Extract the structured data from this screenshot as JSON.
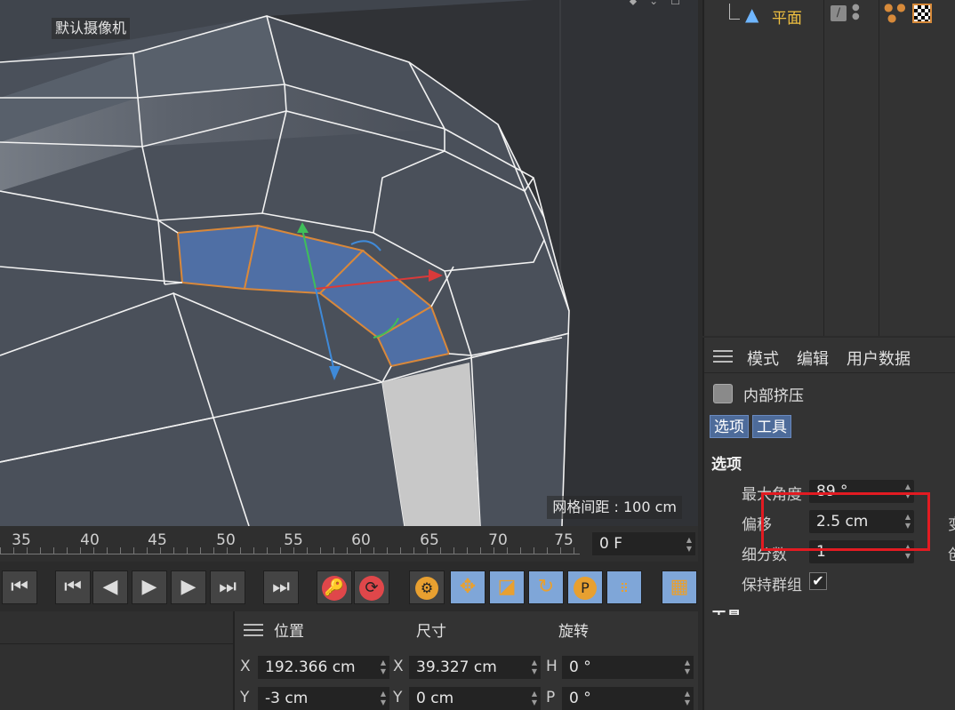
{
  "viewport": {
    "camera_label": "默认摄像机",
    "grid_label": "网格间距 : 100 cm"
  },
  "object_manager": {
    "object_name": "平面",
    "object_icon": "plane-icon",
    "tag_icon": "edit-tag-icon",
    "material_icon": "checker-material-icon"
  },
  "attributes": {
    "menu": [
      "模式",
      "编辑",
      "用户数据"
    ],
    "tool_name": "内部挤压",
    "tabs": [
      "选项",
      "工具"
    ],
    "section": "选项",
    "params": [
      {
        "label": "最大角度",
        "value": "89 °"
      },
      {
        "label": "偏移",
        "value": "2.5 cm"
      },
      {
        "label": "细分数",
        "value": "1"
      }
    ],
    "keep_groups_label": "保持群组",
    "keep_groups_checked": true,
    "next_section": "工具",
    "cut_letters": [
      "变",
      "创"
    ]
  },
  "timeline": {
    "ticks": [
      "35",
      "40",
      "45",
      "50",
      "55",
      "60",
      "65",
      "70",
      "75"
    ],
    "current_frame": "0 F"
  },
  "coordinates": {
    "headers": [
      "位置",
      "尺寸",
      "旋转"
    ],
    "rows": [
      {
        "pos_axis": "X",
        "pos": "192.366 cm",
        "size_axis": "X",
        "size": "39.327 cm",
        "rot_axis": "H",
        "rot": "0 °"
      },
      {
        "pos_axis": "Y",
        "pos": "-3 cm",
        "size_axis": "Y",
        "size": "0 cm",
        "rot_axis": "P",
        "rot": "0 °"
      }
    ]
  },
  "colors": {
    "highlight": "#e21b22",
    "selection": "#4f6fa5",
    "object_name": "#f0c040",
    "tab_active": "#4d6b9a"
  }
}
